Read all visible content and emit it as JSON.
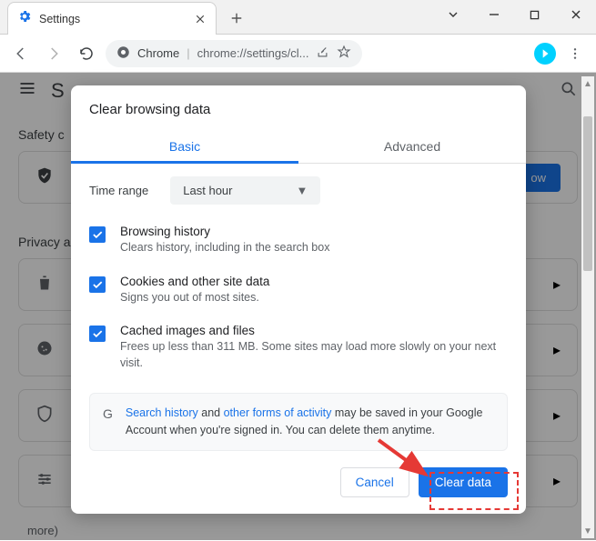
{
  "window": {
    "tab_title": "Settings",
    "address_protocol_label": "Chrome",
    "address_url": "chrome://settings/cl..."
  },
  "page": {
    "title_initial": "S",
    "safety_section": "Safety c",
    "privacy_section": "Privacy a",
    "check_now": "ow",
    "more_trailing": "more)"
  },
  "dialog": {
    "title": "Clear browsing data",
    "tabs": {
      "basic": "Basic",
      "advanced": "Advanced"
    },
    "time_range_label": "Time range",
    "time_range_value": "Last hour",
    "options": [
      {
        "title": "Browsing history",
        "subtitle": "Clears history, including in the search box",
        "checked": true
      },
      {
        "title": "Cookies and other site data",
        "subtitle": "Signs you out of most sites.",
        "checked": true
      },
      {
        "title": "Cached images and files",
        "subtitle": "Frees up less than 311 MB. Some sites may load more slowly on your next visit.",
        "checked": true
      }
    ],
    "notice": {
      "link1": "Search history",
      "mid1": " and ",
      "link2": "other forms of activity",
      "tail": " may be saved in your Google Account when you're signed in. You can delete them anytime."
    },
    "cancel": "Cancel",
    "confirm": "Clear data"
  }
}
